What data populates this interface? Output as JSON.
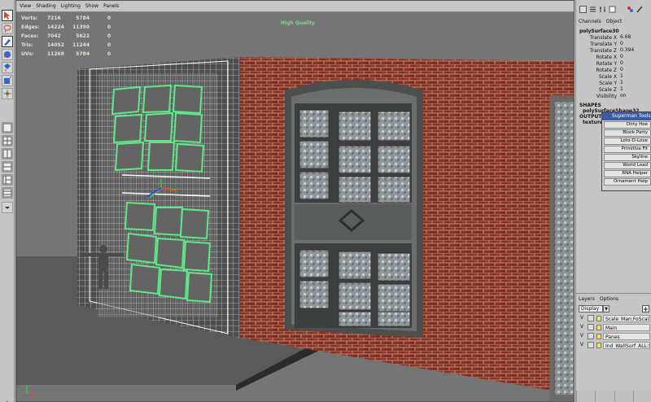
{
  "viewport_menu": [
    "View",
    "Shading",
    "Lighting",
    "Show",
    "Panels"
  ],
  "hud": {
    "rows": [
      {
        "label": "Verts:",
        "a": "7216",
        "b": "5784",
        "c": "0"
      },
      {
        "label": "Edges:",
        "a": "14224",
        "b": "11390",
        "c": "0"
      },
      {
        "label": "Faces:",
        "a": "7042",
        "b": "5622",
        "c": "0"
      },
      {
        "label": "Tris:",
        "a": "14052",
        "b": "11244",
        "c": "0"
      },
      {
        "label": "UVs:",
        "a": "11268",
        "b": "5784",
        "c": "0"
      }
    ],
    "quality": "High Quality"
  },
  "channel_box": {
    "tabs": [
      "Channels",
      "Object"
    ],
    "object": "polySurface30",
    "attributes": [
      {
        "name": "Translate X",
        "value": "6.68"
      },
      {
        "name": "Translate Y",
        "value": "0"
      },
      {
        "name": "Translate Z",
        "value": "0.394"
      },
      {
        "name": "Rotate X",
        "value": "0"
      },
      {
        "name": "Rotate Y",
        "value": "0"
      },
      {
        "name": "Rotate Z",
        "value": "0"
      },
      {
        "name": "Scale X",
        "value": "1"
      },
      {
        "name": "Scale Y",
        "value": "1"
      },
      {
        "name": "Scale Z",
        "value": "1"
      },
      {
        "name": "Visibility",
        "value": "on"
      }
    ],
    "shapes_header": "SHAPES",
    "shape_name": "polySurfaceShape32",
    "outputs_header": "OUTPUTS",
    "texture_name": "textureB"
  },
  "popup": {
    "title": "Superman Tools",
    "items": [
      "Dirty Hoe",
      "Block Party",
      "Loto-O-Love",
      "Primitive Fit",
      "Skyline",
      "World Load",
      "RNA Helper",
      "Ornament Help"
    ]
  },
  "layers": {
    "menu": [
      "Layers",
      "Options"
    ],
    "display_value": "Display",
    "items": [
      {
        "v": "V",
        "name": "Scale_Man:FoScal..."
      },
      {
        "v": "V",
        "name": "Main"
      },
      {
        "v": "V",
        "name": "Panes"
      },
      {
        "v": "V",
        "name": "Ind_WallSurf_ALL:S"
      }
    ]
  },
  "colors": {
    "panel": "#c6c6c6",
    "viewport": "#757575",
    "brick": "#8a3222",
    "wireframe": "#ffffff",
    "selection_green": "#5ee88a",
    "hud_text": "#dfe4d8",
    "highlight_text": "#7dd98a",
    "menu_title": "#3a5ba8",
    "layer_color": "#f2e25a"
  }
}
